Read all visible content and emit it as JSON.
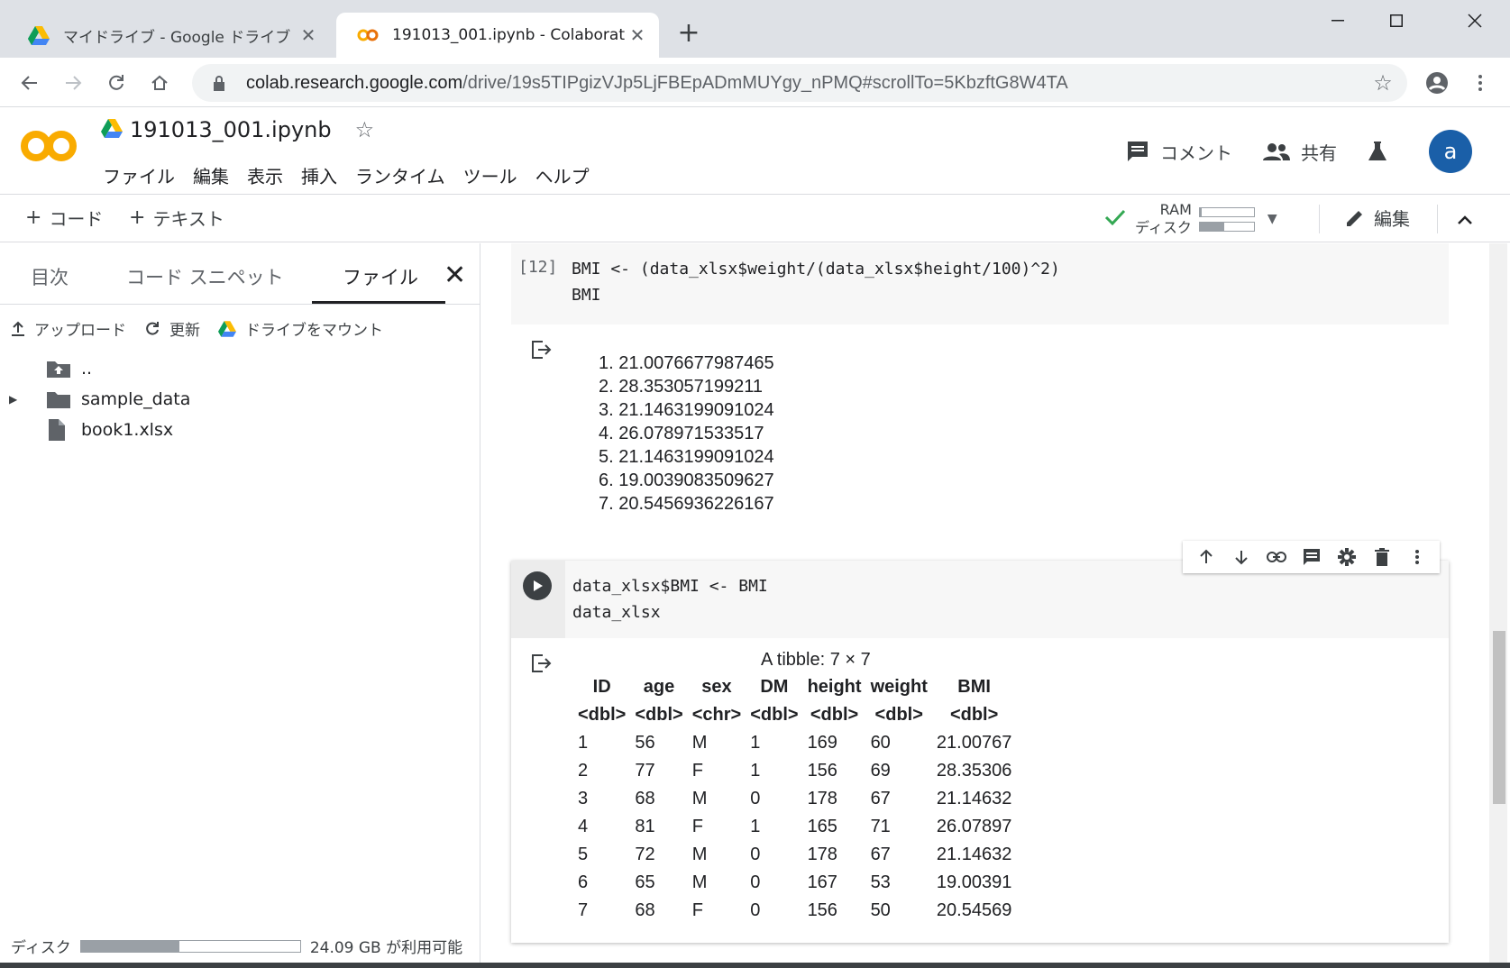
{
  "browser": {
    "tabs": [
      {
        "title": "マイドライブ - Google ドライブ",
        "icon": "google-drive-icon",
        "active": false
      },
      {
        "title": "191013_001.ipynb - Colaboratory",
        "icon": "colab-icon",
        "active": true
      }
    ],
    "url_host": "colab.research.google.com",
    "url_path": "/drive/19s5TIPgizVJp5LjFBEpADmMUYgy_nPMQ#scrollTo=5KbzftG8W4TA"
  },
  "header": {
    "notebook_title": "191013_001.ipynb",
    "menu": [
      "ファイル",
      "編集",
      "表示",
      "挿入",
      "ランタイム",
      "ツール",
      "ヘルプ"
    ],
    "comment_label": "コメント",
    "share_label": "共有",
    "avatar_letter": "a"
  },
  "toolbar": {
    "add_code_label": "コード",
    "add_text_label": "テキスト",
    "ram_label": "RAM",
    "disk_label": "ディスク",
    "ram_usage": 0.04,
    "disk_usage": 0.45,
    "edit_label": "編集"
  },
  "sidepanel": {
    "tabs": [
      "目次",
      "コード スニペット",
      "ファイル"
    ],
    "active_tab": "ファイル",
    "actions": {
      "upload": "アップロード",
      "refresh": "更新",
      "mount": "ドライブをマウント"
    },
    "files": [
      {
        "name": "..",
        "type": "parent-folder"
      },
      {
        "name": "sample_data",
        "type": "folder"
      },
      {
        "name": "book1.xlsx",
        "type": "file"
      }
    ],
    "disk_label": "ディスク",
    "disk_usage": 0.45,
    "disk_available": "24.09 GB が利用可能"
  },
  "cells": {
    "cell1": {
      "exec_count": "[12]",
      "code": "BMI <- (data_xlsx$weight/(data_xlsx$height/100)^2)\nBMI",
      "output_items": [
        "21.0076677987465",
        "28.353057199211",
        "21.1463199091024",
        "26.078971533517",
        "21.1463199091024",
        "19.0039083509627",
        "20.5456936226167"
      ]
    },
    "cell2": {
      "code": "data_xlsx$BMI <- BMI\ndata_xlsx",
      "tibble_caption": "A tibble: 7 × 7",
      "columns": [
        "ID",
        "age",
        "sex",
        "DM",
        "height",
        "weight",
        "BMI"
      ],
      "types": [
        "<dbl>",
        "<dbl>",
        "<chr>",
        "<dbl>",
        "<dbl>",
        "<dbl>",
        "<dbl>"
      ],
      "rows": [
        [
          "1",
          "56",
          "M",
          "1",
          "169",
          "60",
          "21.00767"
        ],
        [
          "2",
          "77",
          "F",
          "1",
          "156",
          "69",
          "28.35306"
        ],
        [
          "3",
          "68",
          "M",
          "0",
          "178",
          "67",
          "21.14632"
        ],
        [
          "4",
          "81",
          "F",
          "1",
          "165",
          "71",
          "26.07897"
        ],
        [
          "5",
          "72",
          "M",
          "0",
          "178",
          "67",
          "21.14632"
        ],
        [
          "6",
          "65",
          "M",
          "0",
          "167",
          "53",
          "19.00391"
        ],
        [
          "7",
          "68",
          "F",
          "0",
          "156",
          "50",
          "20.54569"
        ]
      ]
    }
  },
  "colors": {
    "accent_green": "#34a853",
    "avatar": "#1a5fa8",
    "colab_orange": "#f9ab00"
  }
}
